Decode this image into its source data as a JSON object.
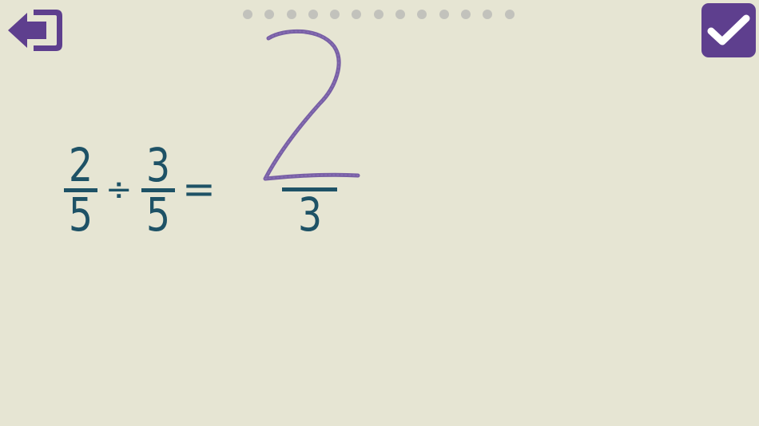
{
  "colors": {
    "background": "#e6e5d3",
    "accent": "#5e3f8e",
    "math_text": "#1e5266",
    "dot_inactive": "#c2c2bc"
  },
  "toolbar": {
    "back_icon": "exit-arrow-icon",
    "check_icon": "checkmark-icon"
  },
  "progress": {
    "total": 13,
    "current": 0
  },
  "equation": {
    "first": {
      "numerator": "2",
      "denominator": "5"
    },
    "operator": "÷",
    "second": {
      "numerator": "3",
      "denominator": "5"
    },
    "equals": "=",
    "answer": {
      "numerator_handwritten": "2",
      "denominator": "3"
    }
  }
}
